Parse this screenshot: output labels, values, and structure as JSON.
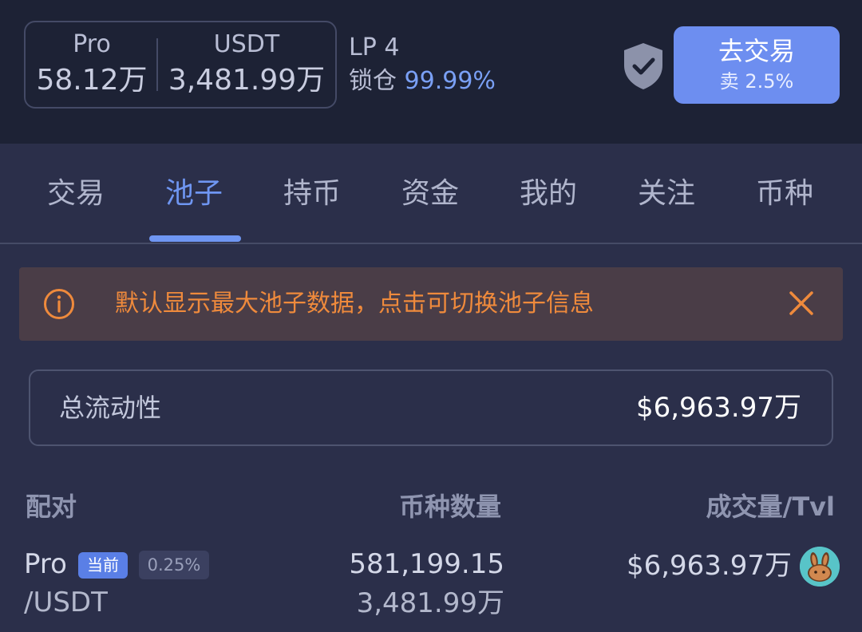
{
  "header": {
    "stat1": {
      "label": "Pro",
      "value": "58.12万"
    },
    "stat2": {
      "label": "USDT",
      "value": "3,481.99万"
    },
    "lp_label": "LP 4",
    "lock_label": "锁仓",
    "lock_value": "99.99%",
    "trade_button": {
      "label": "去交易",
      "sub": "卖 2.5%"
    },
    "accent_color": "#6d8ef0"
  },
  "tabs": [
    {
      "label": "交易"
    },
    {
      "label": "池子"
    },
    {
      "label": "持币"
    },
    {
      "label": "资金"
    },
    {
      "label": "我的"
    },
    {
      "label": "关注"
    },
    {
      "label": "币种"
    }
  ],
  "active_tab": 1,
  "notice": {
    "text": "默认显示最大池子数据，点击可切换池子信息",
    "icon": "info-icon",
    "close_icon": "close-icon",
    "color": "#ef8a3c"
  },
  "liquidity": {
    "label": "总流动性",
    "value": "$6,963.97万"
  },
  "table": {
    "headers": {
      "pair": "配对",
      "amount": "币种数量",
      "volume": "成交量/Tvl"
    },
    "rows": [
      {
        "base": "Pro",
        "quote": "/USDT",
        "badge": "当前",
        "fee": "0.25%",
        "amount_base": "581,199.15",
        "amount_quote": "3,481.99万",
        "volume": "$6,963.97万",
        "dex_icon": "pancakeswap-bunny-icon"
      }
    ]
  }
}
